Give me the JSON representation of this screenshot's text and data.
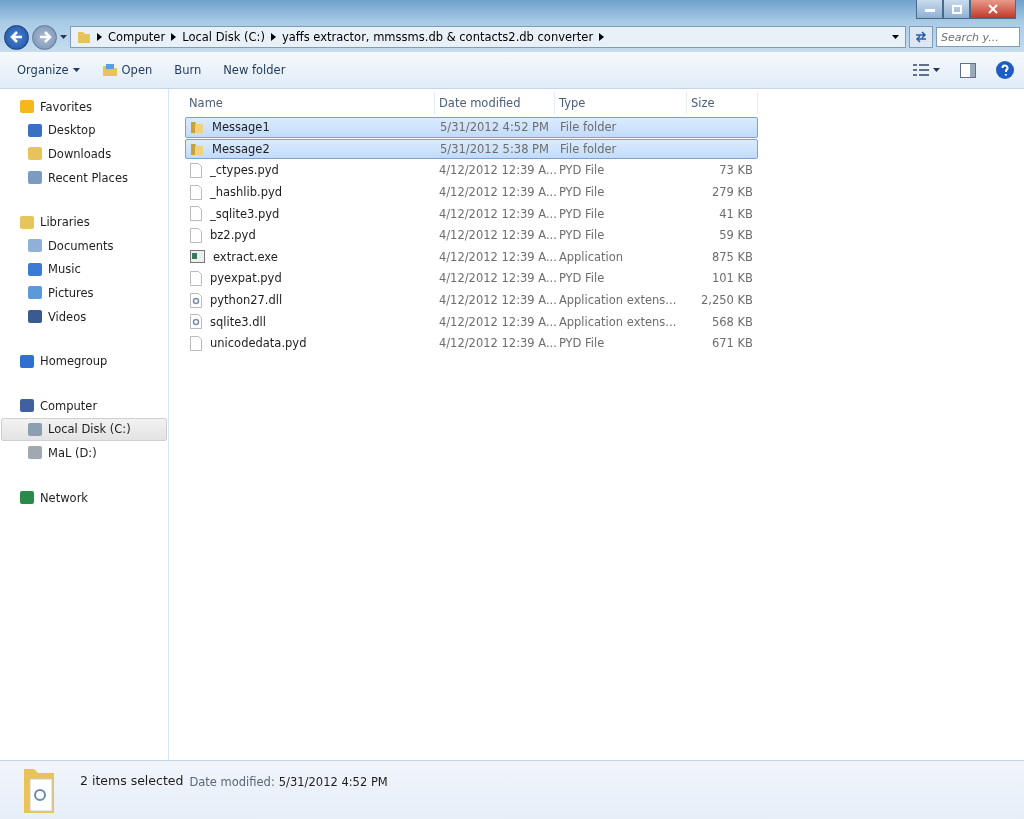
{
  "address": {
    "crumbs": [
      "Computer",
      "Local Disk (C:)",
      "yaffs extractor, mmssms.db & contacts2.db converter"
    ],
    "search_placeholder": "Search y..."
  },
  "toolbar": [
    {
      "label": "Organize",
      "kind": "menu"
    },
    {
      "label": "Open",
      "kind": "icon"
    },
    {
      "label": "Burn",
      "kind": "plain"
    },
    {
      "label": "New folder",
      "kind": "plain"
    }
  ],
  "nav": [
    {
      "label": "Favorites",
      "kind": "star",
      "selected": false,
      "children": [
        {
          "label": "Desktop",
          "kind": "desktop",
          "selected": false
        },
        {
          "label": "Downloads",
          "kind": "folder",
          "selected": false
        },
        {
          "label": "Recent Places",
          "kind": "recent",
          "selected": false
        }
      ]
    },
    {
      "label": "Libraries",
      "kind": "library",
      "selected": false,
      "children": [
        {
          "label": "Documents",
          "kind": "doc",
          "selected": false
        },
        {
          "label": "Music",
          "kind": "music",
          "selected": false
        },
        {
          "label": "Pictures",
          "kind": "picture",
          "selected": false
        },
        {
          "label": "Videos",
          "kind": "video",
          "selected": false
        }
      ]
    },
    {
      "label": "Homegroup",
      "kind": "homegroup",
      "selected": false
    },
    {
      "label": "Computer",
      "kind": "computer",
      "selected": false,
      "children": [
        {
          "label": "Local Disk (C:)",
          "kind": "disk",
          "selected": true
        },
        {
          "label": "MaL (D:)",
          "kind": "drive",
          "selected": false
        }
      ]
    },
    {
      "label": "Network",
      "kind": "network",
      "selected": false
    }
  ],
  "columns": [
    "Name",
    "Date modified",
    "Type",
    "Size"
  ],
  "files": [
    {
      "name": "Message1",
      "date": "5/31/2012 4:52 PM",
      "type": "File folder",
      "kind": "folder",
      "selected": true
    },
    {
      "name": "Message2",
      "date": "5/31/2012 5:38 PM",
      "type": "File folder",
      "kind": "folder",
      "selected": true
    },
    {
      "name": "_ctypes.pyd",
      "date": "4/12/2012 12:39 A...",
      "type": "PYD File",
      "size": "73 KB",
      "kind": "file",
      "selected": false
    },
    {
      "name": "_hashlib.pyd",
      "date": "4/12/2012 12:39 A...",
      "type": "PYD File",
      "size": "279 KB",
      "kind": "file",
      "selected": false
    },
    {
      "name": "_sqlite3.pyd",
      "date": "4/12/2012 12:39 A...",
      "type": "PYD File",
      "size": "41 KB",
      "kind": "file",
      "selected": false
    },
    {
      "name": "bz2.pyd",
      "date": "4/12/2012 12:39 A...",
      "type": "PYD File",
      "size": "59 KB",
      "kind": "file",
      "selected": false
    },
    {
      "name": "extract.exe",
      "date": "4/12/2012 12:39 A...",
      "type": "Application",
      "size": "875 KB",
      "kind": "exe",
      "selected": false
    },
    {
      "name": "pyexpat.pyd",
      "date": "4/12/2012 12:39 A...",
      "type": "PYD File",
      "size": "101 KB",
      "kind": "file",
      "selected": false
    },
    {
      "name": "python27.dll",
      "date": "4/12/2012 12:39 A...",
      "type": "Application extens...",
      "size": "2,250 KB",
      "kind": "dll",
      "selected": false
    },
    {
      "name": "sqlite3.dll",
      "date": "4/12/2012 12:39 A...",
      "type": "Application extens...",
      "size": "568 KB",
      "kind": "dll",
      "selected": false
    },
    {
      "name": "unicodedata.pyd",
      "date": "4/12/2012 12:39 A...",
      "type": "PYD File",
      "size": "671 KB",
      "kind": "file",
      "selected": false
    }
  ],
  "status": {
    "count": "2 items selected",
    "label": "Date modified:",
    "value": "5/31/2012 4:52 PM"
  }
}
